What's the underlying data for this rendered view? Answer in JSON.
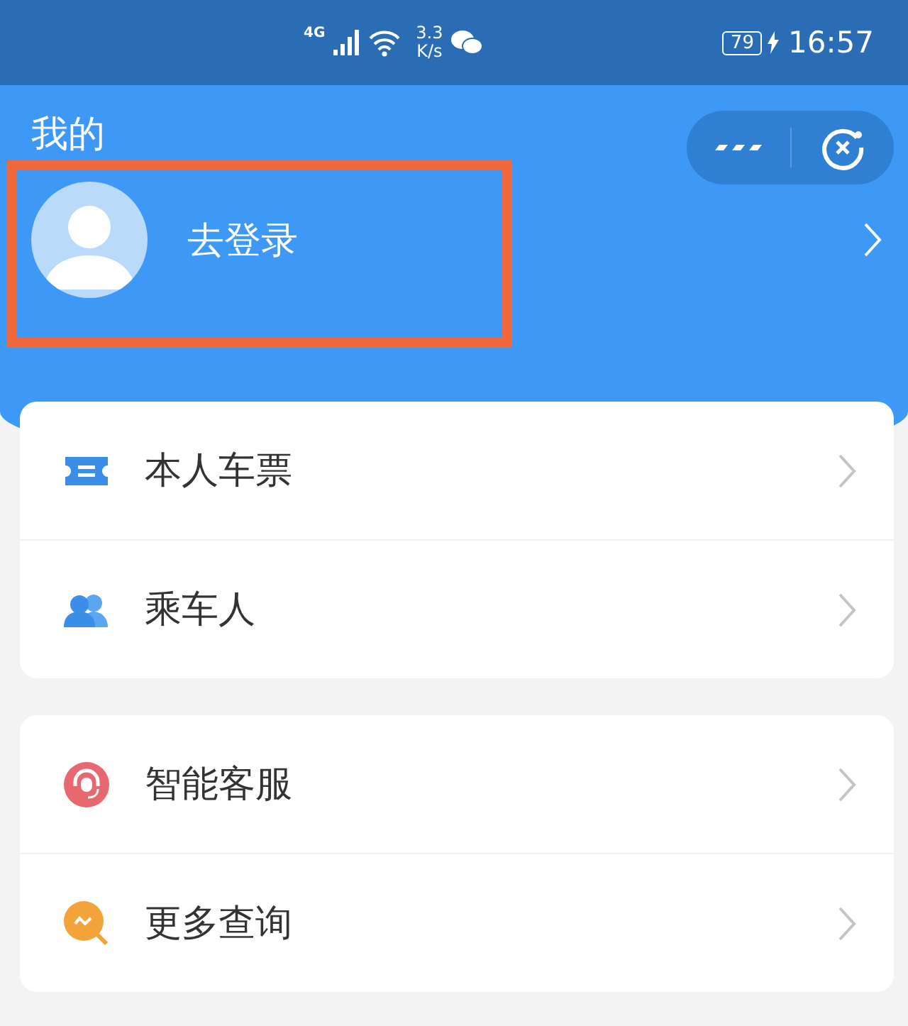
{
  "status_bar": {
    "network": "4G",
    "speed_value": "3.3",
    "speed_unit": "K/s",
    "battery": "79",
    "time": "16:57"
  },
  "header": {
    "title": "我的",
    "login_label": "去登录"
  },
  "groups": [
    {
      "items": [
        {
          "label": "本人车票",
          "kind": "ticket"
        },
        {
          "label": "乘车人",
          "kind": "people"
        }
      ]
    },
    {
      "items": [
        {
          "label": "智能客服",
          "kind": "service"
        },
        {
          "label": "更多查询",
          "kind": "query"
        }
      ]
    }
  ]
}
